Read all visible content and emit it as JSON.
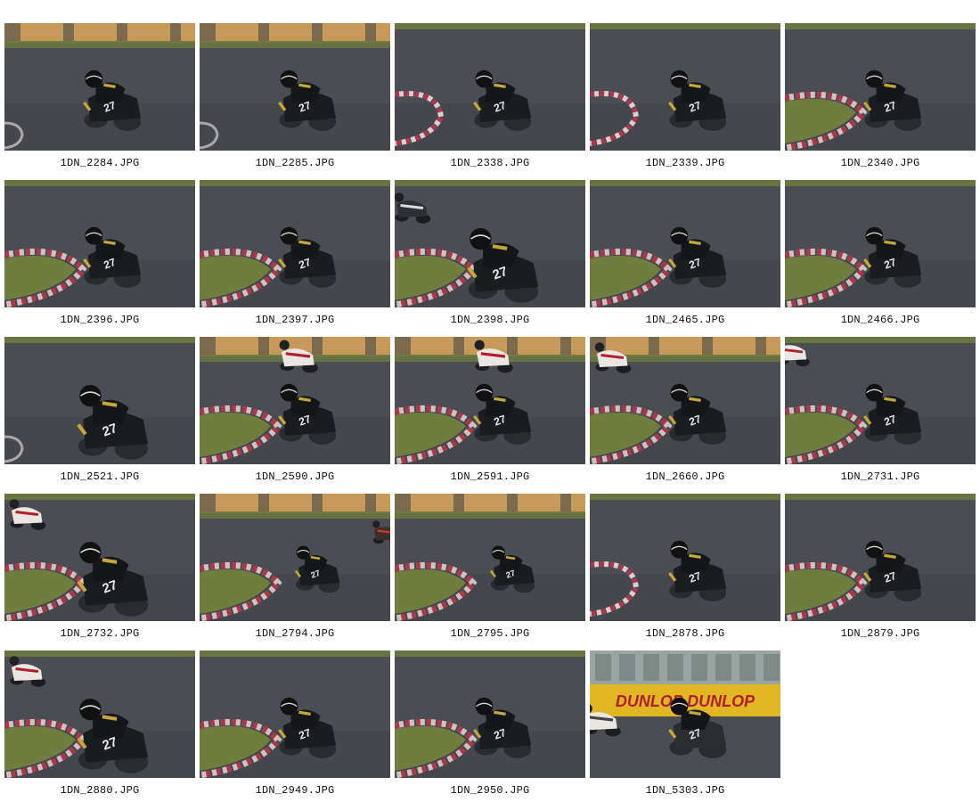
{
  "gallery": {
    "items": [
      {
        "filename": "1DN_2284.JPG",
        "scene": "wall",
        "rider": "left",
        "other": "none"
      },
      {
        "filename": "1DN_2285.JPG",
        "scene": "wall",
        "rider": "left",
        "other": "none"
      },
      {
        "filename": "1DN_2338.JPG",
        "scene": "curb-left",
        "rider": "mid",
        "other": "none"
      },
      {
        "filename": "1DN_2339.JPG",
        "scene": "curb-left",
        "rider": "mid",
        "other": "none"
      },
      {
        "filename": "1DN_2340.JPG",
        "scene": "grass-curb",
        "rider": "mid",
        "other": "none"
      },
      {
        "filename": "1DN_2396.JPG",
        "scene": "grass-curb",
        "rider": "mid",
        "other": "none"
      },
      {
        "filename": "1DN_2397.JPG",
        "scene": "grass-curb",
        "rider": "mid",
        "other": "none"
      },
      {
        "filename": "1DN_2398.JPG",
        "scene": "grass-curb",
        "rider": "big",
        "other": "dark-top-left"
      },
      {
        "filename": "1DN_2465.JPG",
        "scene": "grass-curb",
        "rider": "mid",
        "other": "none"
      },
      {
        "filename": "1DN_2466.JPG",
        "scene": "grass-curb",
        "rider": "mid",
        "other": "none"
      },
      {
        "filename": "1DN_2521.JPG",
        "scene": "plain",
        "rider": "big",
        "other": "none"
      },
      {
        "filename": "1DN_2590.JPG",
        "scene": "wall-grass",
        "rider": "mid",
        "other": "white-behind"
      },
      {
        "filename": "1DN_2591.JPG",
        "scene": "wall-grass",
        "rider": "mid",
        "other": "white-behind"
      },
      {
        "filename": "1DN_2660.JPG",
        "scene": "wall-grass",
        "rider": "mid",
        "other": "white-top-left"
      },
      {
        "filename": "1DN_2731.JPG",
        "scene": "grass-curb",
        "rider": "mid",
        "other": "white-edge"
      },
      {
        "filename": "1DN_2732.JPG",
        "scene": "grass-curb",
        "rider": "big",
        "other": "white-top-left"
      },
      {
        "filename": "1DN_2794.JPG",
        "scene": "wall-grass",
        "rider": "small",
        "other": "edge-right"
      },
      {
        "filename": "1DN_2795.JPG",
        "scene": "wall-grass",
        "rider": "small",
        "other": "none"
      },
      {
        "filename": "1DN_2878.JPG",
        "scene": "curb-left",
        "rider": "mid",
        "other": "none"
      },
      {
        "filename": "1DN_2879.JPG",
        "scene": "grass-curb",
        "rider": "mid",
        "other": "none"
      },
      {
        "filename": "1DN_2880.JPG",
        "scene": "grass-curb",
        "rider": "big",
        "other": "white-top-left"
      },
      {
        "filename": "1DN_2949.JPG",
        "scene": "grass-curb",
        "rider": "mid",
        "other": "none"
      },
      {
        "filename": "1DN_2950.JPG",
        "scene": "grass-curb",
        "rider": "mid",
        "other": "none"
      },
      {
        "filename": "1DN_5303.JPG",
        "scene": "dunlop",
        "rider": "mid",
        "other": "white-left",
        "banner_text": "DUNLOP DUNLOP"
      }
    ]
  },
  "colors": {
    "asphalt": "#4b4d52",
    "asphalt_dark": "#3b3d42",
    "grass": "#6f7d3e",
    "curb_red": "#a8384a",
    "curb_white": "#d8d0d0",
    "wall": "#c79a5c",
    "bike": "#1b1c1f",
    "helmet": "#111111",
    "accent_yellow": "#c4a83a",
    "banner": "#e2b523",
    "banner_text": "#b0202a",
    "caption_text": "#111111"
  }
}
